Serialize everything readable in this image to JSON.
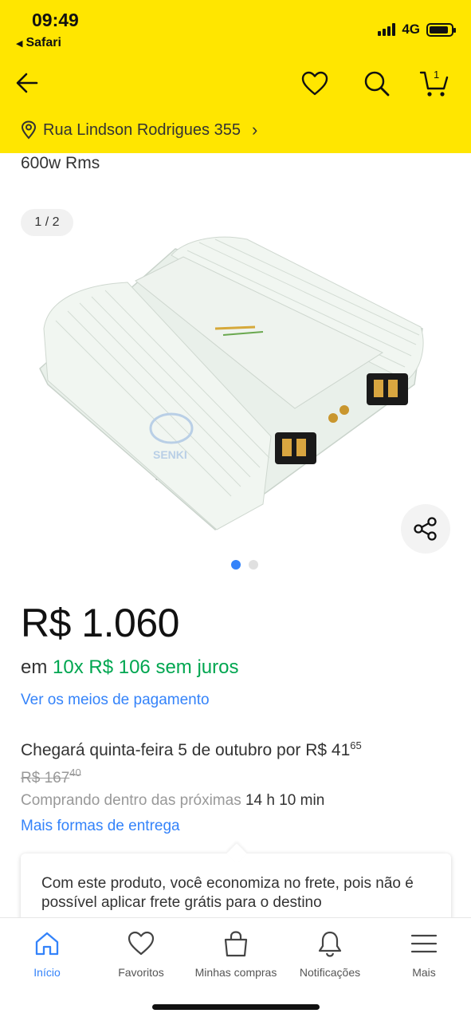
{
  "status_bar": {
    "time": "09:49",
    "back_app": "Safari",
    "network": "4G",
    "battery_level": 0.9
  },
  "header": {
    "cart_count": "1",
    "address": "Rua Lindson Rodrigues 355",
    "icons": [
      "back-arrow-icon",
      "heart-icon",
      "search-icon",
      "cart-icon",
      "location-pin-icon",
      "chevron-right-icon"
    ]
  },
  "product": {
    "subtitle": "600w Rms",
    "image_counter": "1 / 2",
    "image_brand_text": "SENKI",
    "image_count": 2,
    "active_image": 1
  },
  "pricing": {
    "price": "R$ 1.060",
    "installments_prefix": "em",
    "installments_highlight": "10x R$ 106 sem juros",
    "payment_link": "Ver os meios de pagamento"
  },
  "shipping": {
    "arrival_text": "Chegará quinta-feira 5 de outubro por R$ 41",
    "arrival_cents": "65",
    "old_price": "R$ 167",
    "old_price_cents": "40",
    "window_prefix": "Comprando dentro das próximas",
    "window_time": "14 h 10 min",
    "more_options_link": "Mais formas de entrega"
  },
  "tooltip": {
    "text": "Com este produto, você economiza no frete, pois não é possível aplicar frete grátis para o destino"
  },
  "tabbar": {
    "items": [
      {
        "label": "Início",
        "icon": "home-icon",
        "active": true
      },
      {
        "label": "Favoritos",
        "icon": "heart-icon",
        "active": false
      },
      {
        "label": "Minhas compras",
        "icon": "shopping-bag-icon",
        "active": false
      },
      {
        "label": "Notificações",
        "icon": "bell-icon",
        "active": false
      },
      {
        "label": "Mais",
        "icon": "menu-icon",
        "active": false
      }
    ]
  },
  "colors": {
    "header_yellow": "#ffe600",
    "link_blue": "#3483fa",
    "installment_green": "#00a650"
  }
}
